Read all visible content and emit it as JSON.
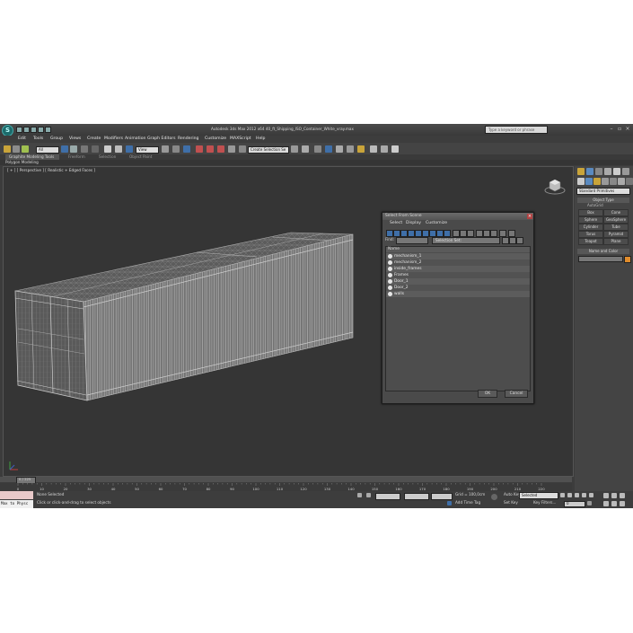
{
  "title_bar": {
    "title": "Autodesk 3ds Max 2012 x64     40_ft_Shipping_ISO_Container_White_vray.max",
    "search_placeholder": "Type a keyword or phrase",
    "logo_letter": "S"
  },
  "menu": [
    "Edit",
    "Tools",
    "Group",
    "Views",
    "Create",
    "Modifiers",
    "Animation",
    "Graph Editors",
    "Rendering",
    "Customize",
    "MAXScript",
    "Help"
  ],
  "toolbar": {
    "filter_value": "All",
    "view_value": "View",
    "selection_set_value": "Create Selection Se"
  },
  "ribbon": {
    "tabs": [
      "Graphite Modeling Tools",
      "Freeform",
      "Selection",
      "Object Paint"
    ],
    "panel_label": "Polygon Modeling"
  },
  "viewport": {
    "label": "[ + ] [ Perspective ] [ Realistic + Edged Faces ]"
  },
  "command_panel": {
    "category_value": "Standard Primitives",
    "object_type_header": "Object Type",
    "autogrid_label": "AutoGrid",
    "primitives": [
      "Box",
      "Cone",
      "Sphere",
      "GeoSphere",
      "Cylinder",
      "Tube",
      "Torus",
      "Pyramid",
      "Teapot",
      "Plane"
    ],
    "name_color_header": "Name and Color"
  },
  "select_dialog": {
    "title": "Select From Scene",
    "menu": [
      "Select",
      "Display",
      "Customize"
    ],
    "find_label": "Find:",
    "selection_set_label": "Selection Set:",
    "column_name": "Name",
    "items": [
      "mechanism_1",
      "mechanism_2",
      "inside_frames",
      "Frames",
      "Door_1",
      "Door_2",
      "walls"
    ],
    "ok_label": "OK",
    "cancel_label": "Cancel"
  },
  "timeline": {
    "frame_counter": "0 / 225",
    "ticks": [
      "0",
      "10",
      "20",
      "30",
      "40",
      "50",
      "60",
      "70",
      "80",
      "90",
      "100",
      "110",
      "120",
      "130",
      "140",
      "150",
      "160",
      "170",
      "180",
      "190",
      "200",
      "210",
      "220"
    ]
  },
  "status": {
    "maxscript_text": "Max to Physc",
    "selection_status": "None Selected",
    "prompt": "Click or click-and-drag to select objects",
    "grid": "Grid = 100,0cm",
    "add_time_tag": "Add Time Tag",
    "auto_key": "Auto Key",
    "auto_key_value": "Selected",
    "set_key": "Set Key",
    "key_filters": "Key Filters...",
    "frame_value": "0"
  },
  "colors": {
    "app_bg": "#3c3c3c",
    "viewport_bg": "#353535",
    "accent_blue": "#3f6fa8",
    "wire": "#b8b8b8"
  }
}
